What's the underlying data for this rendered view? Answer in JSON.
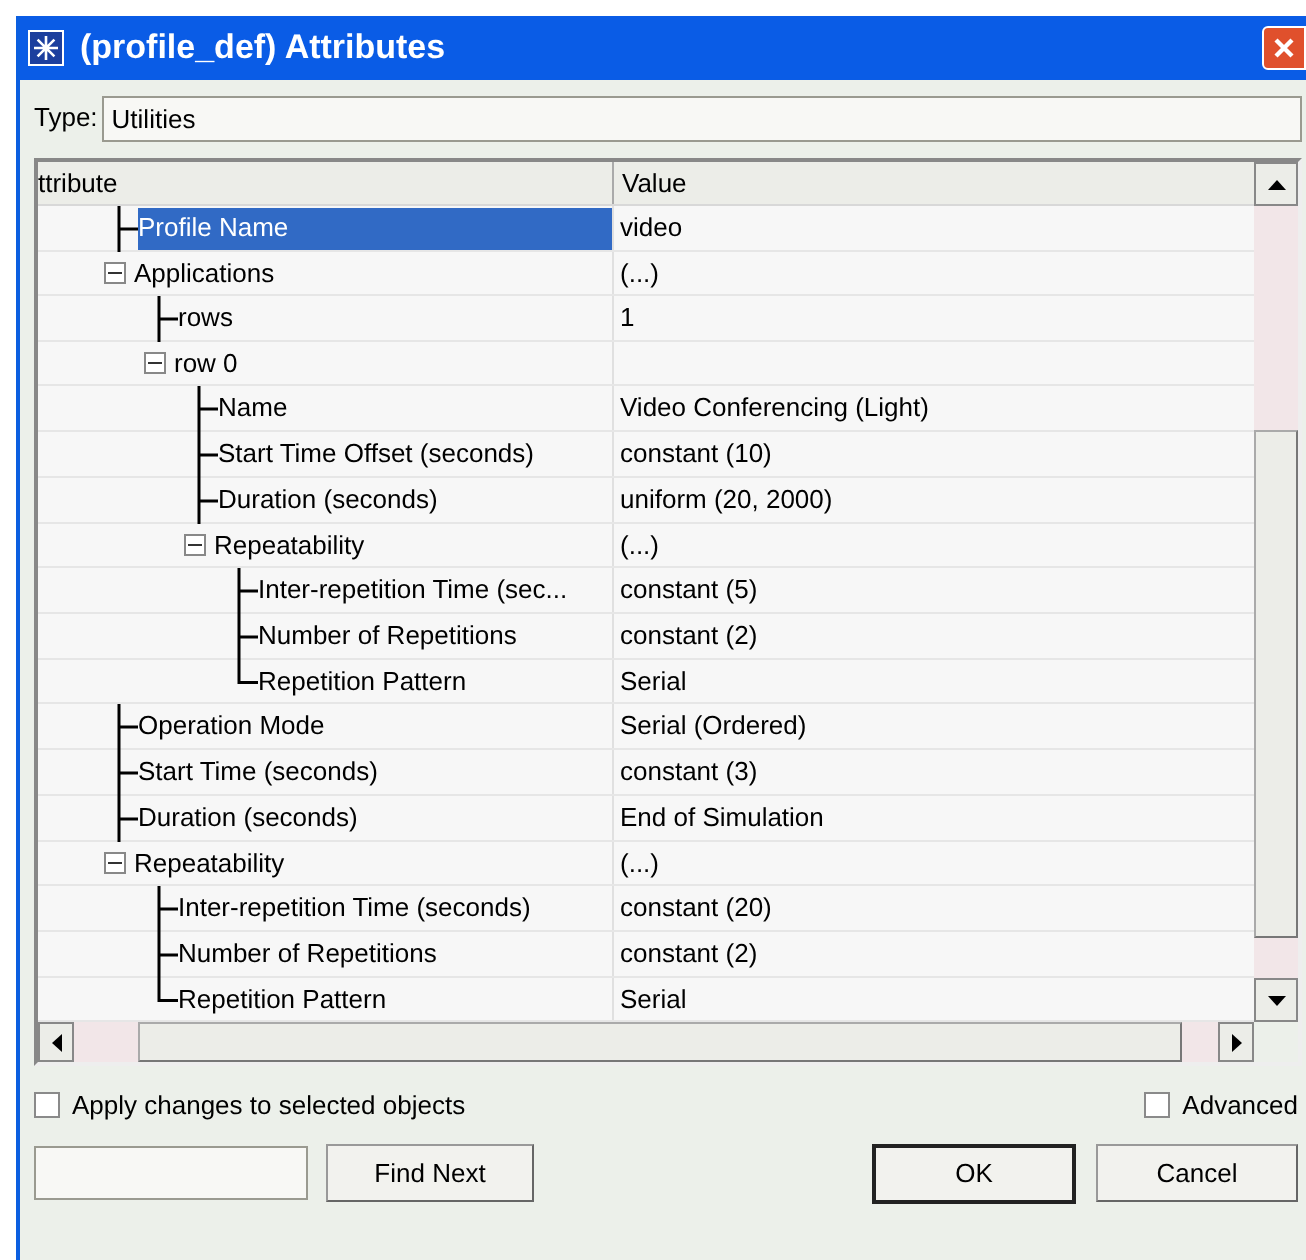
{
  "window": {
    "title": "(profile_def) Attributes"
  },
  "type_field": {
    "label": "Type:",
    "value": "Utilities"
  },
  "table": {
    "columns": [
      "ttribute",
      "Value"
    ],
    "rows": [
      {
        "name": "Profile Name",
        "value": "video",
        "selected": true
      },
      {
        "name": "Applications",
        "value": "(...)",
        "selected": false,
        "expanded": true,
        "children": [
          {
            "name": "rows",
            "value": "1",
            "selected": false
          },
          {
            "name": "row 0",
            "selected": false,
            "expanded": true,
            "children": [
              {
                "name": "Name",
                "value": "Video Conferencing (Light)",
                "selected": false
              },
              {
                "name": "Start Time Offset (seconds)",
                "value": "constant (10)",
                "selected": false
              },
              {
                "name": "Duration (seconds)",
                "value": "uniform (20, 2000)",
                "selected": false
              },
              {
                "name": "Repeatability",
                "value": "(...)",
                "selected": false,
                "expanded": true,
                "children": [
                  {
                    "name": "Inter-repetition Time (sec...",
                    "value": "constant (5)",
                    "selected": false
                  },
                  {
                    "name": "Number of Repetitions",
                    "value": "constant (2)",
                    "selected": false
                  },
                  {
                    "name": "Repetition Pattern",
                    "value": "Serial",
                    "selected": false
                  }
                ]
              }
            ]
          }
        ]
      },
      {
        "name": "Operation Mode",
        "value": "Serial (Ordered)",
        "selected": false
      },
      {
        "name": "Start Time (seconds)",
        "value": "constant (3)",
        "selected": false
      },
      {
        "name": "Duration (seconds)",
        "value": "End of Simulation",
        "selected": false
      },
      {
        "name": "Repeatability",
        "value": "(...)",
        "selected": false,
        "expanded": true,
        "children": [
          {
            "name": "Inter-repetition Time (seconds)",
            "value": "constant (20)",
            "selected": false
          },
          {
            "name": "Number of Repetitions",
            "value": "constant (2)",
            "selected": false
          },
          {
            "name": "Repetition Pattern",
            "value": "Serial",
            "selected": false
          }
        ]
      }
    ]
  },
  "options": [
    {
      "label": "Apply changes to selected objects",
      "checked": false
    },
    {
      "label": "Advanced",
      "checked": false
    }
  ],
  "find": {
    "button": "Find Next"
  },
  "buttons": [
    "OK",
    "Cancel"
  ]
}
